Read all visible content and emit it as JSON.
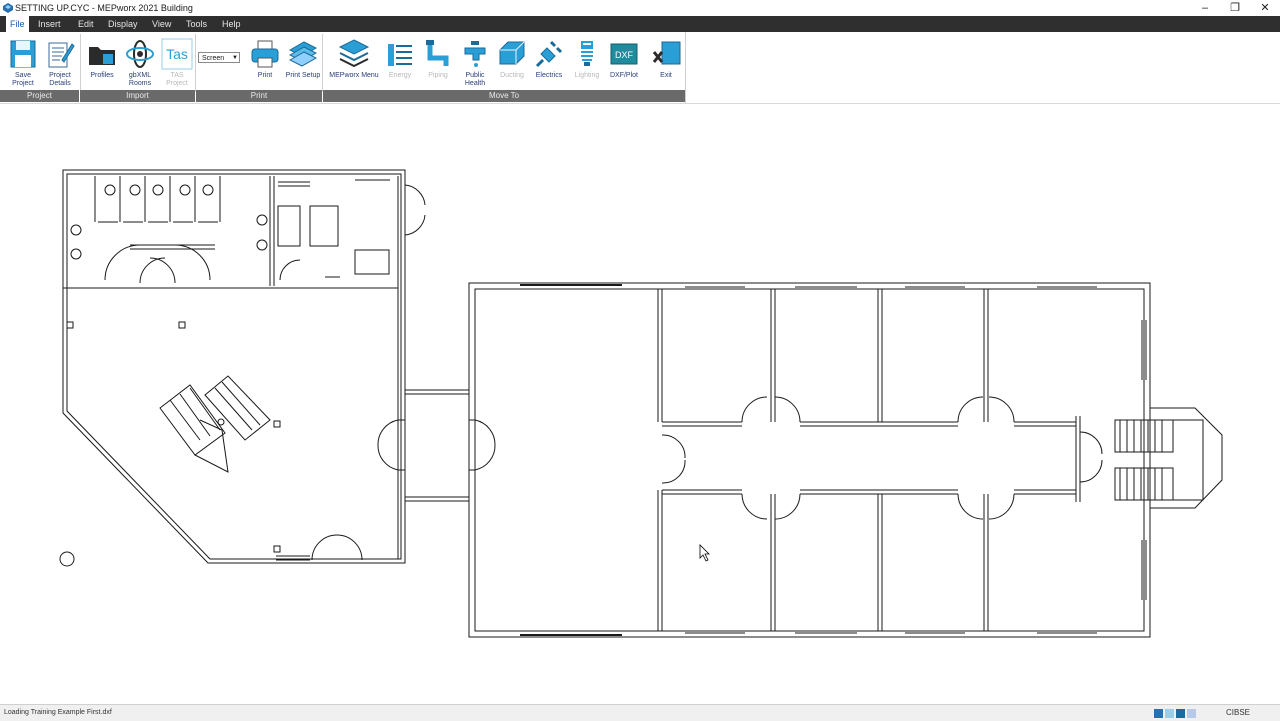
{
  "window": {
    "title": "SETTING UP.CYC - MEPworx 2021 Building",
    "min": "–",
    "max": "❐",
    "close": "✕"
  },
  "menu": [
    {
      "label": "File",
      "active": true
    },
    {
      "label": "Insert"
    },
    {
      "label": "Edit"
    },
    {
      "label": "Display"
    },
    {
      "label": "View"
    },
    {
      "label": "Tools"
    },
    {
      "label": "Help"
    }
  ],
  "ribbon": {
    "save_project": "Save Project",
    "project_details": "Project Details",
    "profiles": "Profiles",
    "gbxml_rooms": "gbXML Rooms",
    "tas_logo": "Tas",
    "tas_project": "TAS Project",
    "screen_select": "Screen",
    "print": "Print",
    "print_setup": "Print Setup",
    "mepworx_menu": "MEPworx Menu",
    "energy": "Energy",
    "piping": "Piping",
    "public_health": "Public Health",
    "ducting": "Ducting",
    "electrics": "Electrics",
    "lighting": "Lighting",
    "dxf_plot": "DXF/Plot",
    "dxf_logo": "DXF",
    "exit": "Exit",
    "groups": {
      "project": "Project",
      "import": "Import",
      "print": "Print",
      "move_to": "Move To"
    }
  },
  "status": {
    "message": "Loading Training Example First.dxf",
    "standard": "CIBSE"
  },
  "colors": {
    "menubar": "#2f2f2f",
    "accent": "#2a9fd6",
    "group_label": "#6a6a6a",
    "drawing": "#1a1a1a"
  }
}
